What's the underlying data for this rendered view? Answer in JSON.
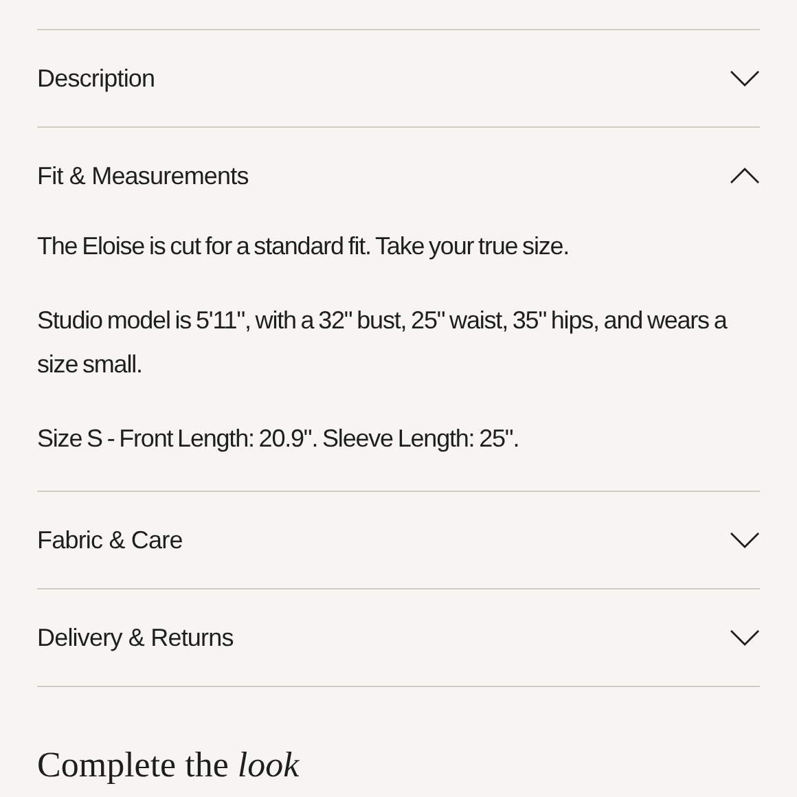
{
  "sections": [
    {
      "title": "Description",
      "expanded": false
    },
    {
      "title": "Fit & Measurements",
      "expanded": true,
      "paragraphs": [
        "The Eloise is cut for a standard fit. Take your true size.",
        "Studio model is 5'11\", with a 32\" bust, 25\" waist, 35\" hips, and wears a size small.",
        "Size S - Front Length: 20.9\". Sleeve Length: 25\"."
      ]
    },
    {
      "title": "Fabric & Care",
      "expanded": false
    },
    {
      "title": "Delivery & Returns",
      "expanded": false
    }
  ],
  "heading": "Complete the *look*"
}
